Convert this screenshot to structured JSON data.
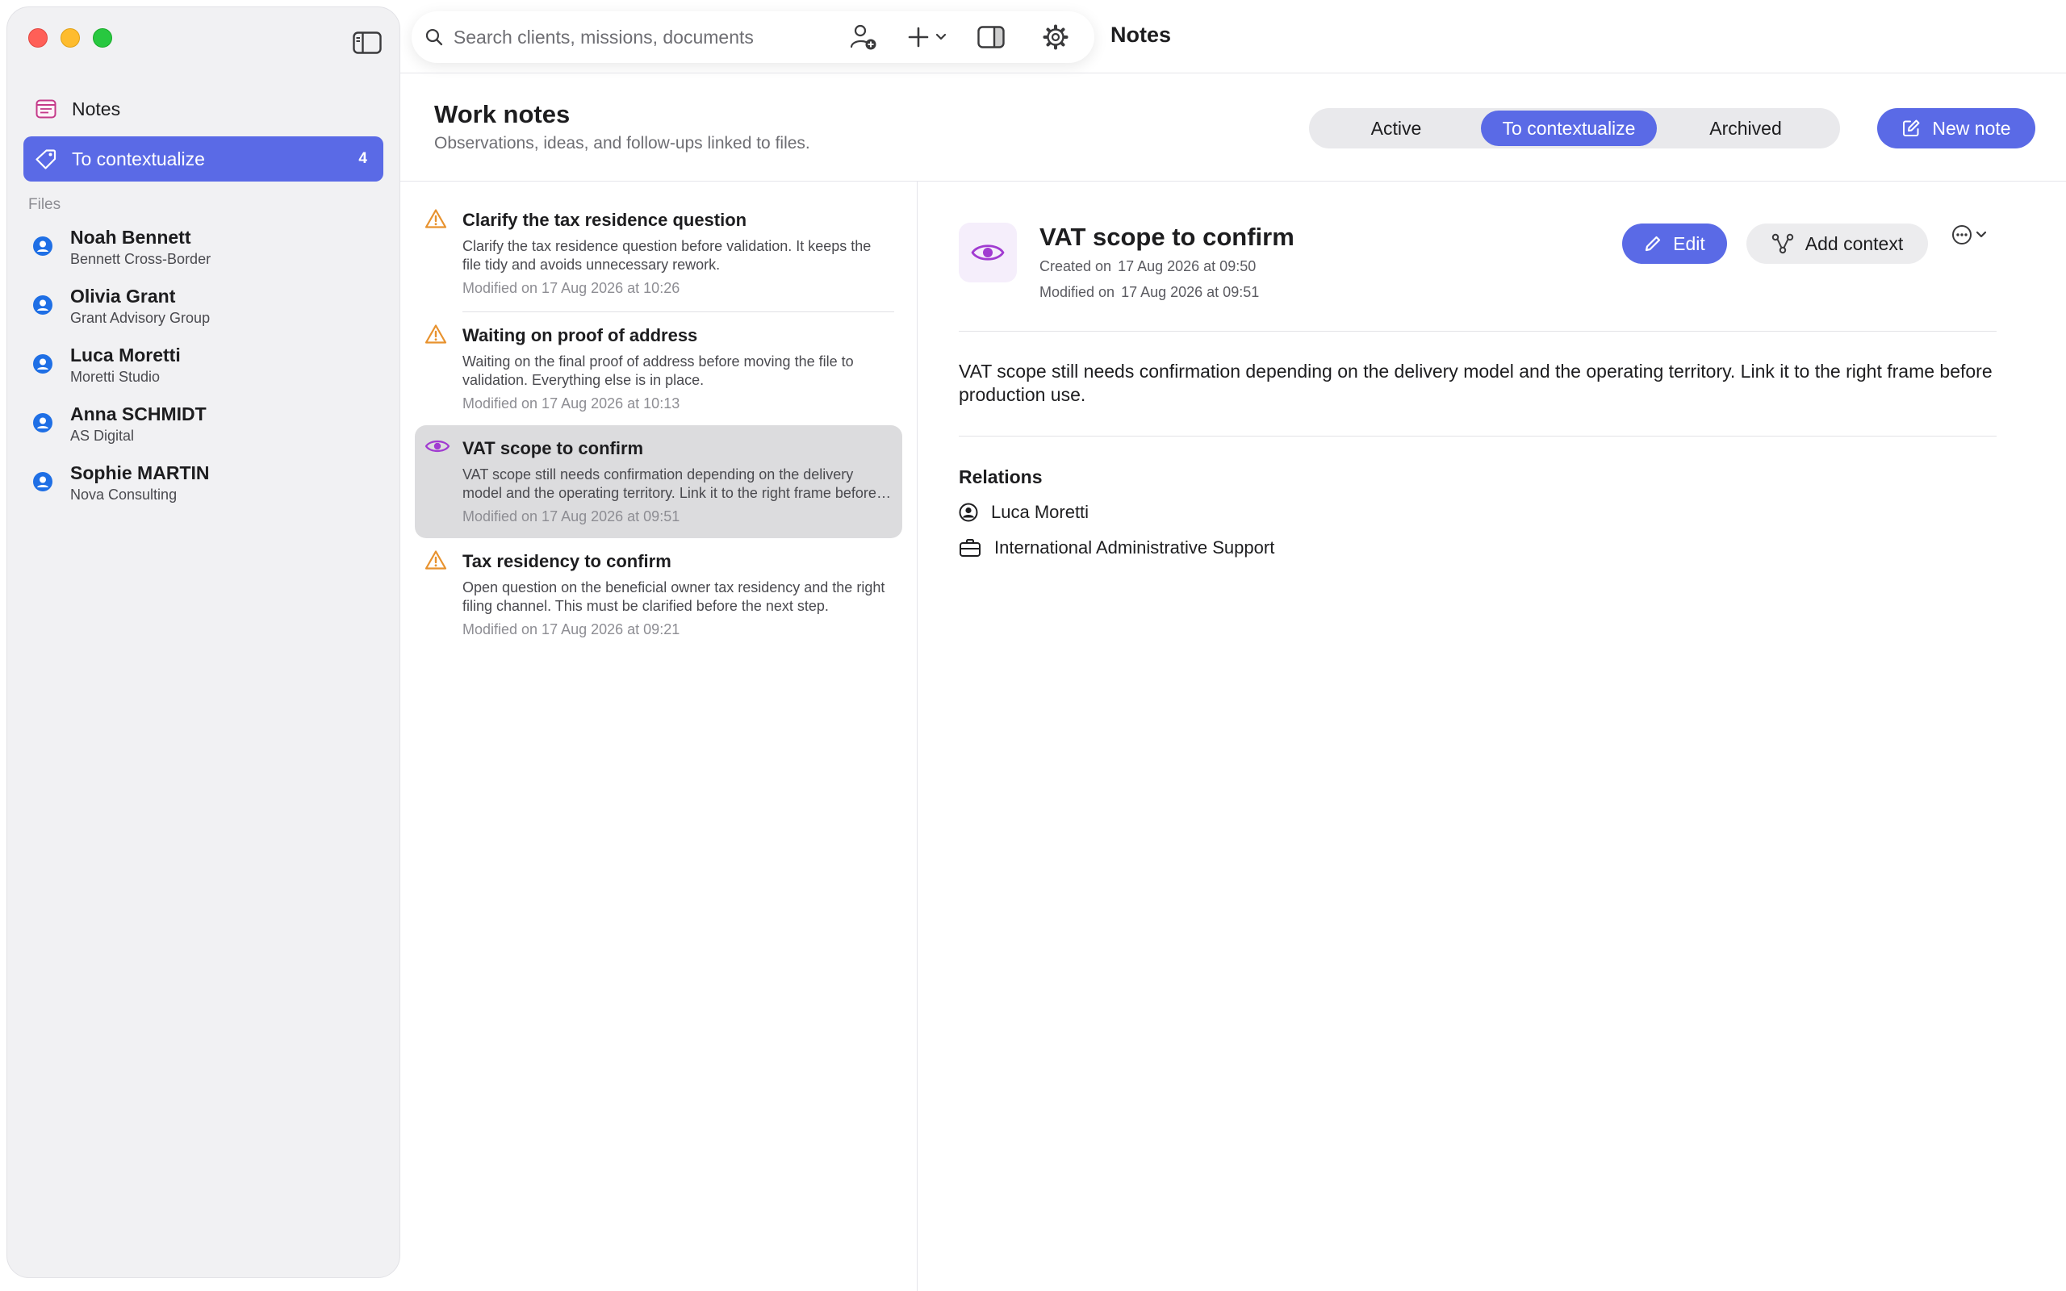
{
  "sidebar": {
    "nav": [
      {
        "label": "Notes"
      },
      {
        "label": "To contextualize",
        "badge": "4"
      }
    ],
    "files_header": "Files",
    "files": [
      {
        "name": "Noah Bennett",
        "company": "Bennett Cross-Border"
      },
      {
        "name": "Olivia Grant",
        "company": "Grant Advisory Group"
      },
      {
        "name": "Luca Moretti",
        "company": "Moretti Studio"
      },
      {
        "name": "Anna SCHMIDT",
        "company": "AS Digital"
      },
      {
        "name": "Sophie MARTIN",
        "company": "Nova Consulting"
      }
    ]
  },
  "toolbar": {
    "search_placeholder": "Search clients, missions, documents",
    "title": "Notes"
  },
  "header": {
    "title": "Work notes",
    "subtitle": "Observations, ideas, and follow-ups linked to files.",
    "tabs": [
      {
        "label": "Active"
      },
      {
        "label": "To contextualize"
      },
      {
        "label": "Archived"
      }
    ],
    "new_note_label": "New note"
  },
  "notes": [
    {
      "title": "Clarify the tax residence question",
      "excerpt": "Clarify the tax residence question before validation. It keeps the file tidy and avoids unnecessary rework.",
      "modified": "Modified on 17 Aug 2026 at 10:26",
      "icon": "warning-icon"
    },
    {
      "title": "Waiting on proof of address",
      "excerpt": "Waiting on the final proof of address before moving the file to validation. Everything else is in place.",
      "modified": "Modified on 17 Aug 2026 at 10:13",
      "icon": "warning-icon"
    },
    {
      "title": "VAT scope to confirm",
      "excerpt": "VAT scope still needs confirmation depending on the delivery model and the operating territory. Link it to the right frame before production use.",
      "modified": "Modified on 17 Aug 2026 at 09:51",
      "icon": "eye-icon"
    },
    {
      "title": "Tax residency to confirm",
      "excerpt": "Open question on the beneficial owner tax residency and the right filing channel. This must be clarified before the next step.",
      "modified": "Modified on 17 Aug 2026 at 09:21",
      "icon": "warning-icon"
    }
  ],
  "detail": {
    "title": "VAT scope to confirm",
    "created_label": "Created on",
    "created_value": "17 Aug 2026 at 09:50",
    "modified_label": "Modified on",
    "modified_value": "17 Aug 2026 at 09:51",
    "edit_label": "Edit",
    "add_context_label": "Add context",
    "body": "VAT scope still needs confirmation depending on the delivery model and the operating territory. Link it to the right frame before production use.",
    "relations_title": "Relations",
    "relations": [
      {
        "label": "Luca Moretti",
        "icon": "person-circle-icon"
      },
      {
        "label": "International Administrative Support",
        "icon": "briefcase-icon"
      }
    ]
  },
  "colors": {
    "accent": "#5a6ae6",
    "warning": "#e8922e",
    "eye": "#a13bd1",
    "file_avatar": "#1f6fe5"
  }
}
